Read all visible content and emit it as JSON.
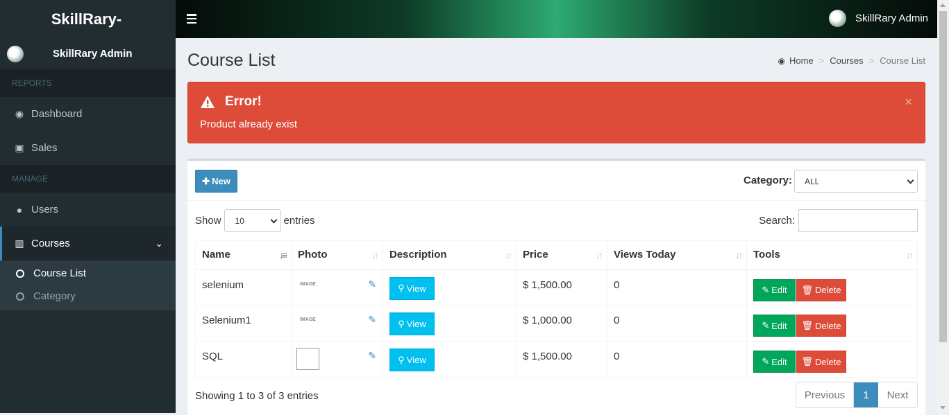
{
  "sidebar": {
    "logo": "SkillRary-",
    "user_name": "SkillRary Admin",
    "reports_header": "REPORTS",
    "manage_header": "MANAGE",
    "items": {
      "dashboard": "Dashboard",
      "sales": "Sales",
      "users": "Users",
      "courses": "Courses"
    },
    "submenu": {
      "course_list": "Course List",
      "category": "Category"
    }
  },
  "topbar": {
    "user_name": "SkillRary Admin"
  },
  "page": {
    "title": "Course List",
    "breadcrumb": [
      "Home",
      "Courses",
      "Course List"
    ]
  },
  "alert": {
    "title": "Error!",
    "message": "Product already exist",
    "close": "×"
  },
  "toolbar": {
    "new_label": "New",
    "category_label": "Category:",
    "category_value": "ALL"
  },
  "table_controls": {
    "show_label": "Show",
    "entries_value": "10",
    "entries_label": "entries",
    "search_label": "Search:"
  },
  "table": {
    "headers": [
      "Name",
      "Photo",
      "Description",
      "Price",
      "Views Today",
      "Tools"
    ],
    "rows": [
      {
        "name": "selenium",
        "price": "$ 1,500.00",
        "views": "0",
        "photo": "image"
      },
      {
        "name": "Selenium1",
        "price": "$ 1,000.00",
        "views": "0",
        "photo": "image"
      },
      {
        "name": "SQL",
        "price": "$ 1,500.00",
        "views": "0",
        "photo": "broken"
      }
    ],
    "view_label": "View",
    "edit_label": "Edit",
    "delete_label": "Delete"
  },
  "footer": {
    "info": "Showing 1 to 3 of 3 entries",
    "previous": "Previous",
    "page": "1",
    "next": "Next"
  },
  "colors": {
    "primary": "#3c8dbc",
    "danger": "#dd4b39",
    "success": "#00a65a",
    "info": "#00c0ef",
    "sidebar": "#222d32"
  }
}
